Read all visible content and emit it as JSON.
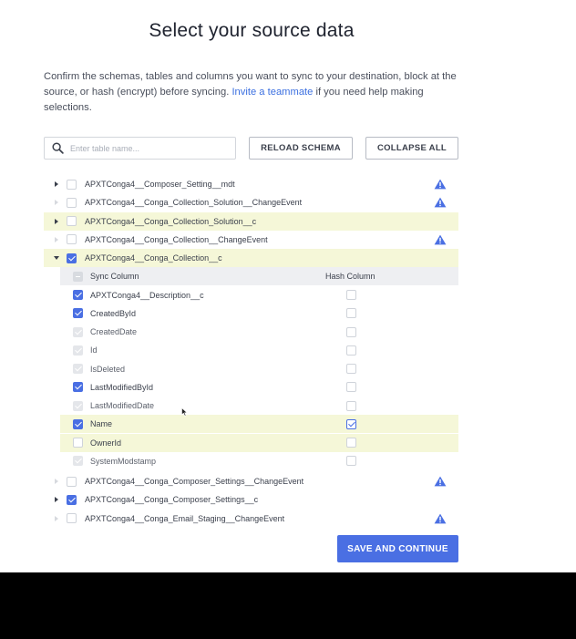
{
  "title": "Select your source data",
  "description": {
    "before_link": "Confirm the schemas, tables and columns you want to sync to your destination, block at the source, or hash (encrypt) before syncing. ",
    "link": "Invite a teammate",
    "after_link": " if you need help making selections."
  },
  "search": {
    "placeholder": "Enter table name..."
  },
  "buttons": {
    "reload": "RELOAD SCHEMA",
    "collapse": "COLLAPSE ALL",
    "save": "SAVE AND CONTINUE"
  },
  "tables": [
    {
      "name": "APXTConga4__Composer_Setting__mdt",
      "checked": false,
      "caret": "dark",
      "warning": true,
      "highlight": false
    },
    {
      "name": "APXTConga4__Conga_Collection_Solution__ChangeEvent",
      "checked": false,
      "caret": "light",
      "warning": true,
      "highlight": false
    },
    {
      "name": "APXTConga4__Conga_Collection_Solution__c",
      "checked": false,
      "caret": "dark",
      "warning": false,
      "highlight": true
    },
    {
      "name": "APXTConga4__Conga_Collection__ChangeEvent",
      "checked": false,
      "caret": "light",
      "warning": true,
      "highlight": false
    },
    {
      "name": "APXTConga4__Conga_Collection__c",
      "checked": true,
      "caret": "open",
      "warning": false,
      "highlight": true
    }
  ],
  "column_headers": {
    "sync": "Sync Column",
    "hash": "Hash Column"
  },
  "columns": [
    {
      "name": "APXTConga4__Description__c",
      "sync": "on",
      "hash": false,
      "highlight": false
    },
    {
      "name": "CreatedById",
      "sync": "on",
      "hash": false,
      "highlight": false
    },
    {
      "name": "CreatedDate",
      "sync": "disabled",
      "hash": false,
      "highlight": false
    },
    {
      "name": "Id",
      "sync": "disabled",
      "hash": false,
      "highlight": false
    },
    {
      "name": "IsDeleted",
      "sync": "disabled",
      "hash": false,
      "highlight": false
    },
    {
      "name": "LastModifiedById",
      "sync": "on",
      "hash": false,
      "highlight": false
    },
    {
      "name": "LastModifiedDate",
      "sync": "disabled",
      "hash": false,
      "highlight": false
    },
    {
      "name": "Name",
      "sync": "on",
      "hash": true,
      "highlight": true
    },
    {
      "name": "OwnerId",
      "sync": "off",
      "hash": false,
      "highlight": true
    },
    {
      "name": "SystemModstamp",
      "sync": "disabled",
      "hash": false,
      "highlight": false
    }
  ],
  "tables_after": [
    {
      "name": "APXTConga4__Conga_Composer_Settings__ChangeEvent",
      "checked": false,
      "caret": "light",
      "warning": true,
      "highlight": false
    },
    {
      "name": "APXTConga4__Conga_Composer_Settings__c",
      "checked": true,
      "caret": "dark",
      "warning": false,
      "highlight": false
    },
    {
      "name": "APXTConga4__Conga_Email_Staging__ChangeEvent",
      "checked": false,
      "caret": "light",
      "warning": true,
      "highlight": false
    }
  ],
  "colors": {
    "accent": "#4a6fe3",
    "highlight": "#f5f7d8",
    "warning": "#4a6fe3"
  }
}
